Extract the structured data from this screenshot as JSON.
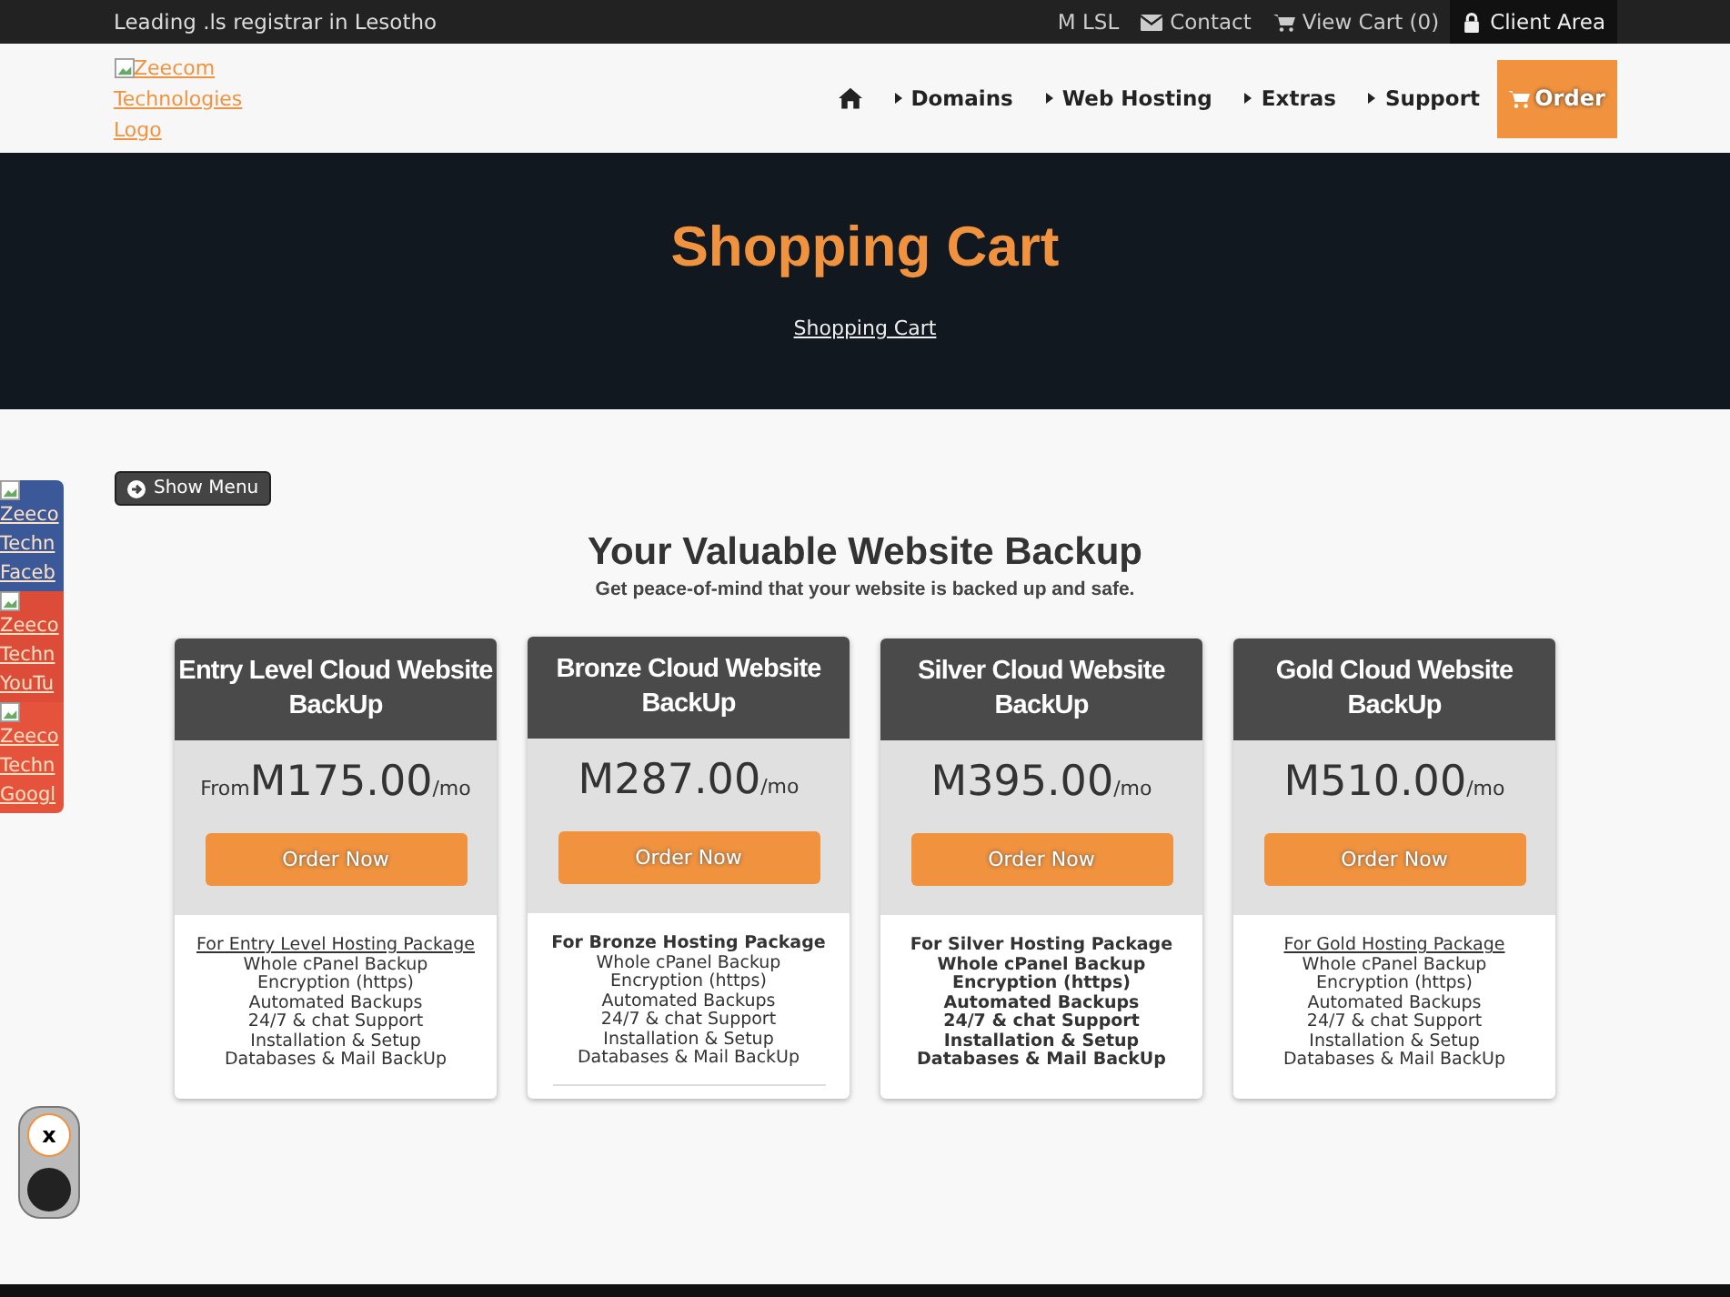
{
  "top_bar": {
    "tagline": "Leading .ls registrar in Lesotho",
    "currency": "M LSL",
    "links": [
      {
        "kind": "contact",
        "label": "Contact",
        "selected": false
      },
      {
        "kind": "cart",
        "label": "View Cart (0)",
        "selected": false
      },
      {
        "kind": "account",
        "label": "Client Area",
        "selected": true
      }
    ]
  },
  "header": {
    "logo_alt": "Zeecom Technologies Logo",
    "nav": [
      {
        "kind": "home"
      },
      {
        "kind": "menu",
        "label": "Domains"
      },
      {
        "kind": "menu",
        "label": "Web Hosting"
      },
      {
        "kind": "menu",
        "label": "Extras"
      },
      {
        "kind": "menu",
        "label": "Support"
      },
      {
        "kind": "order",
        "label": "Order"
      }
    ]
  },
  "hero": {
    "title": "Shopping Cart",
    "breadcrumb": "Shopping Cart"
  },
  "social": [
    {
      "color": "#3b5998",
      "lines": [
        "Zeeco",
        "Techn",
        "Faceb"
      ]
    },
    {
      "color": "#dd4b39",
      "lines": [
        "Zeeco",
        "Techn",
        "YouTu"
      ]
    },
    {
      "color": "#e5533d",
      "lines": [
        "Zeeco",
        "Techn",
        "Googl"
      ]
    }
  ],
  "show_menu": "Show Menu",
  "section": {
    "title": "Your Valuable Website Backup",
    "subtitle": "Get peace-of-mind that your website is backed up and safe."
  },
  "plans": [
    {
      "name": "Entry Level Cloud Website BackUp",
      "prefix": "From",
      "price": "M175.00",
      "period": "/mo",
      "button": "Order Now",
      "heading": {
        "kind": "link",
        "text": "For Entry Level Hosting Package"
      },
      "bold_features": false,
      "divider": false,
      "features": [
        "Whole cPanel Backup",
        "Encryption (https)",
        "Automated Backups",
        "24/7 & chat Support",
        "Installation & Setup",
        "Databases & Mail BackUp"
      ]
    },
    {
      "name": "Bronze Cloud Website BackUp",
      "price": "M287.00",
      "period": "/mo",
      "button": "Order Now",
      "heading": {
        "kind": "bold",
        "text": "For Bronze Hosting Package"
      },
      "bold_features": false,
      "divider": true,
      "features": [
        "Whole cPanel Backup",
        "Encryption (https)",
        "Automated Backups",
        "24/7 & chat Support",
        "Installation & Setup",
        "Databases & Mail BackUp"
      ]
    },
    {
      "name": "Silver Cloud Website BackUp",
      "price": "M395.00",
      "period": "/mo",
      "button": "Order Now",
      "heading": {
        "kind": "bold",
        "text": "For Silver Hosting Package"
      },
      "bold_features": true,
      "divider": false,
      "features": [
        "Whole cPanel Backup",
        "Encryption (https)",
        "Automated Backups",
        "24/7 & chat Support",
        "Installation & Setup",
        "Databases & Mail BackUp"
      ]
    },
    {
      "name": "Gold Cloud Website BackUp",
      "price": "M510.00",
      "period": "/mo",
      "button": "Order Now",
      "heading": {
        "kind": "link",
        "text": "For Gold Hosting Package"
      },
      "bold_features": false,
      "divider": false,
      "features": [
        "Whole cPanel Backup",
        "Encryption (https)",
        "Automated Backups",
        "24/7 & chat Support",
        "Installation & Setup",
        "Databases & Mail BackUp"
      ]
    }
  ],
  "widget": {
    "close": "x"
  }
}
